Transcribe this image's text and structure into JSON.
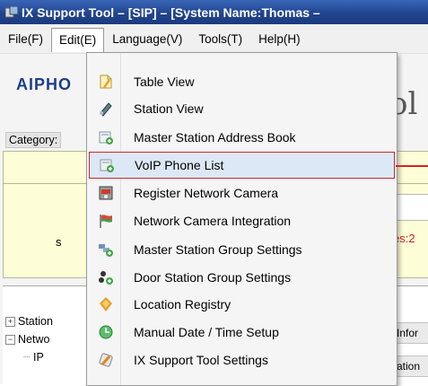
{
  "window": {
    "title": "IX Support Tool – [SIP] – [System Name:Thomas –"
  },
  "menubar": {
    "items": [
      {
        "label": "File(F)",
        "open": false
      },
      {
        "label": "Edit(E)",
        "open": true
      },
      {
        "label": "Language(V)",
        "open": false
      },
      {
        "label": "Tools(T)",
        "open": false
      },
      {
        "label": "Help(H)",
        "open": false
      }
    ]
  },
  "background": {
    "logo": "AIPHO",
    "big_title": "ol",
    "category_label": "Category:",
    "res_text": "es:2",
    "s_letter": "s",
    "tree": [
      {
        "label": "Station",
        "expander": "+"
      },
      {
        "label": "Netwo",
        "expander": "−"
      },
      {
        "label": "IP",
        "expander": ""
      }
    ],
    "grid_cells": [
      "Infor",
      "ation"
    ]
  },
  "edit_menu": {
    "items": [
      {
        "label": "Table View",
        "icon": "table-view-icon",
        "highlighted": false
      },
      {
        "label": "Station View",
        "icon": "station-view-icon",
        "highlighted": false
      },
      {
        "label": "Master Station Address Book",
        "icon": "address-book-icon",
        "highlighted": false
      },
      {
        "label": "VoIP Phone List",
        "icon": "voip-phone-list-icon",
        "highlighted": true
      },
      {
        "label": "Register Network Camera",
        "icon": "register-camera-icon",
        "highlighted": false
      },
      {
        "label": "Network Camera Integration",
        "icon": "camera-integration-icon",
        "highlighted": false
      },
      {
        "label": "Master Station Group Settings",
        "icon": "master-group-icon",
        "highlighted": false
      },
      {
        "label": "Door Station Group Settings",
        "icon": "door-group-icon",
        "highlighted": false
      },
      {
        "label": "Location Registry",
        "icon": "location-registry-icon",
        "highlighted": false
      },
      {
        "label": "Manual Date / Time Setup",
        "icon": "date-time-icon",
        "highlighted": false
      },
      {
        "label": "IX Support Tool Settings",
        "icon": "settings-icon",
        "highlighted": false
      }
    ]
  },
  "colors": {
    "titlebar": "#22458f",
    "highlight_border": "#d0252b",
    "highlight_fill": "#dde8f6",
    "panel_yellow": "#fdfdd8"
  }
}
